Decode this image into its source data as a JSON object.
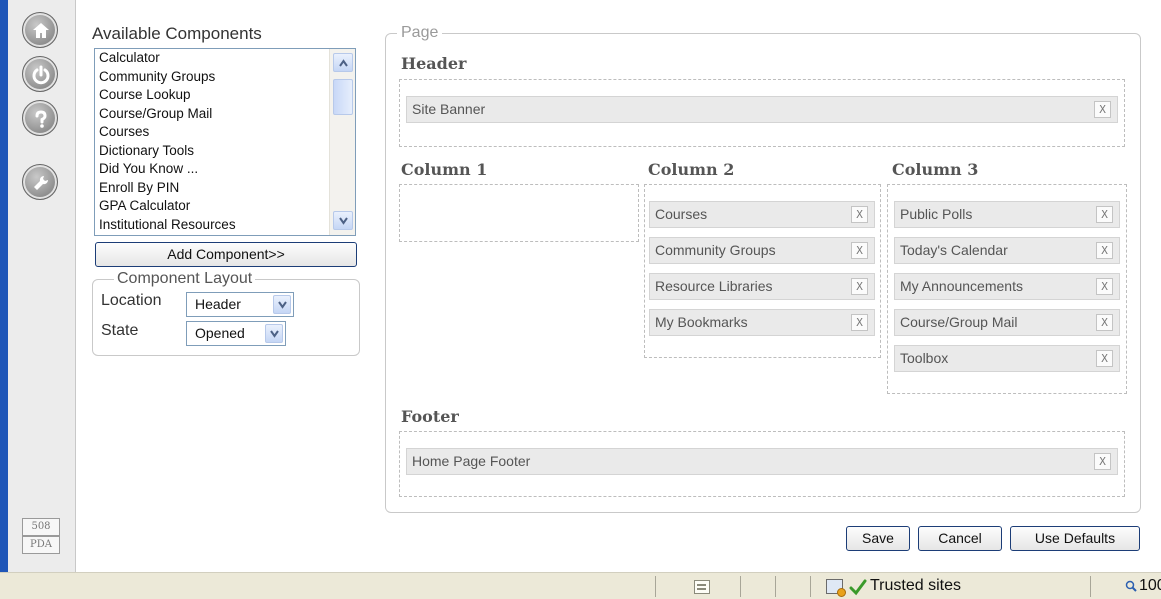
{
  "nav": {
    "icons": [
      "home-icon",
      "power-icon",
      "help-icon",
      "tools-icon"
    ],
    "modes": [
      "508",
      "PDA"
    ]
  },
  "available": {
    "title": "Available Components",
    "items": [
      "Calculator",
      "Community Groups",
      "Course Lookup",
      "Course/Group Mail",
      "Courses",
      "Dictionary Tools",
      "Did You Know ...",
      "Enroll By PIN",
      "GPA Calculator",
      "Institutional Resources"
    ],
    "add_label": "Add Component>>"
  },
  "layout": {
    "legend": "Component Layout",
    "location_label": "Location",
    "location_value": "Header",
    "state_label": "State",
    "state_value": "Opened"
  },
  "page": {
    "legend": "Page",
    "header": {
      "title": "Header",
      "items": [
        "Site Banner"
      ]
    },
    "column1": {
      "title": "Column 1",
      "items": []
    },
    "column2": {
      "title": "Column 2",
      "items": [
        "Courses",
        "Community Groups",
        "Resource Libraries",
        "My Bookmarks"
      ]
    },
    "column3": {
      "title": "Column 3",
      "items": [
        "Public Polls",
        "Today's Calendar",
        "My Announcements",
        "Course/Group Mail",
        "Toolbox"
      ]
    },
    "footer": {
      "title": "Footer",
      "items": [
        "Home Page Footer"
      ]
    },
    "remove_label": "X"
  },
  "actions": {
    "save": "Save",
    "cancel": "Cancel",
    "defaults": "Use Defaults"
  },
  "status": {
    "zone": "Trusted sites",
    "zoom": "100"
  },
  "colors": {
    "accent": "#1f56b8",
    "dashed_border": "#bdbdbd",
    "component_bg": "#eaeaea"
  }
}
